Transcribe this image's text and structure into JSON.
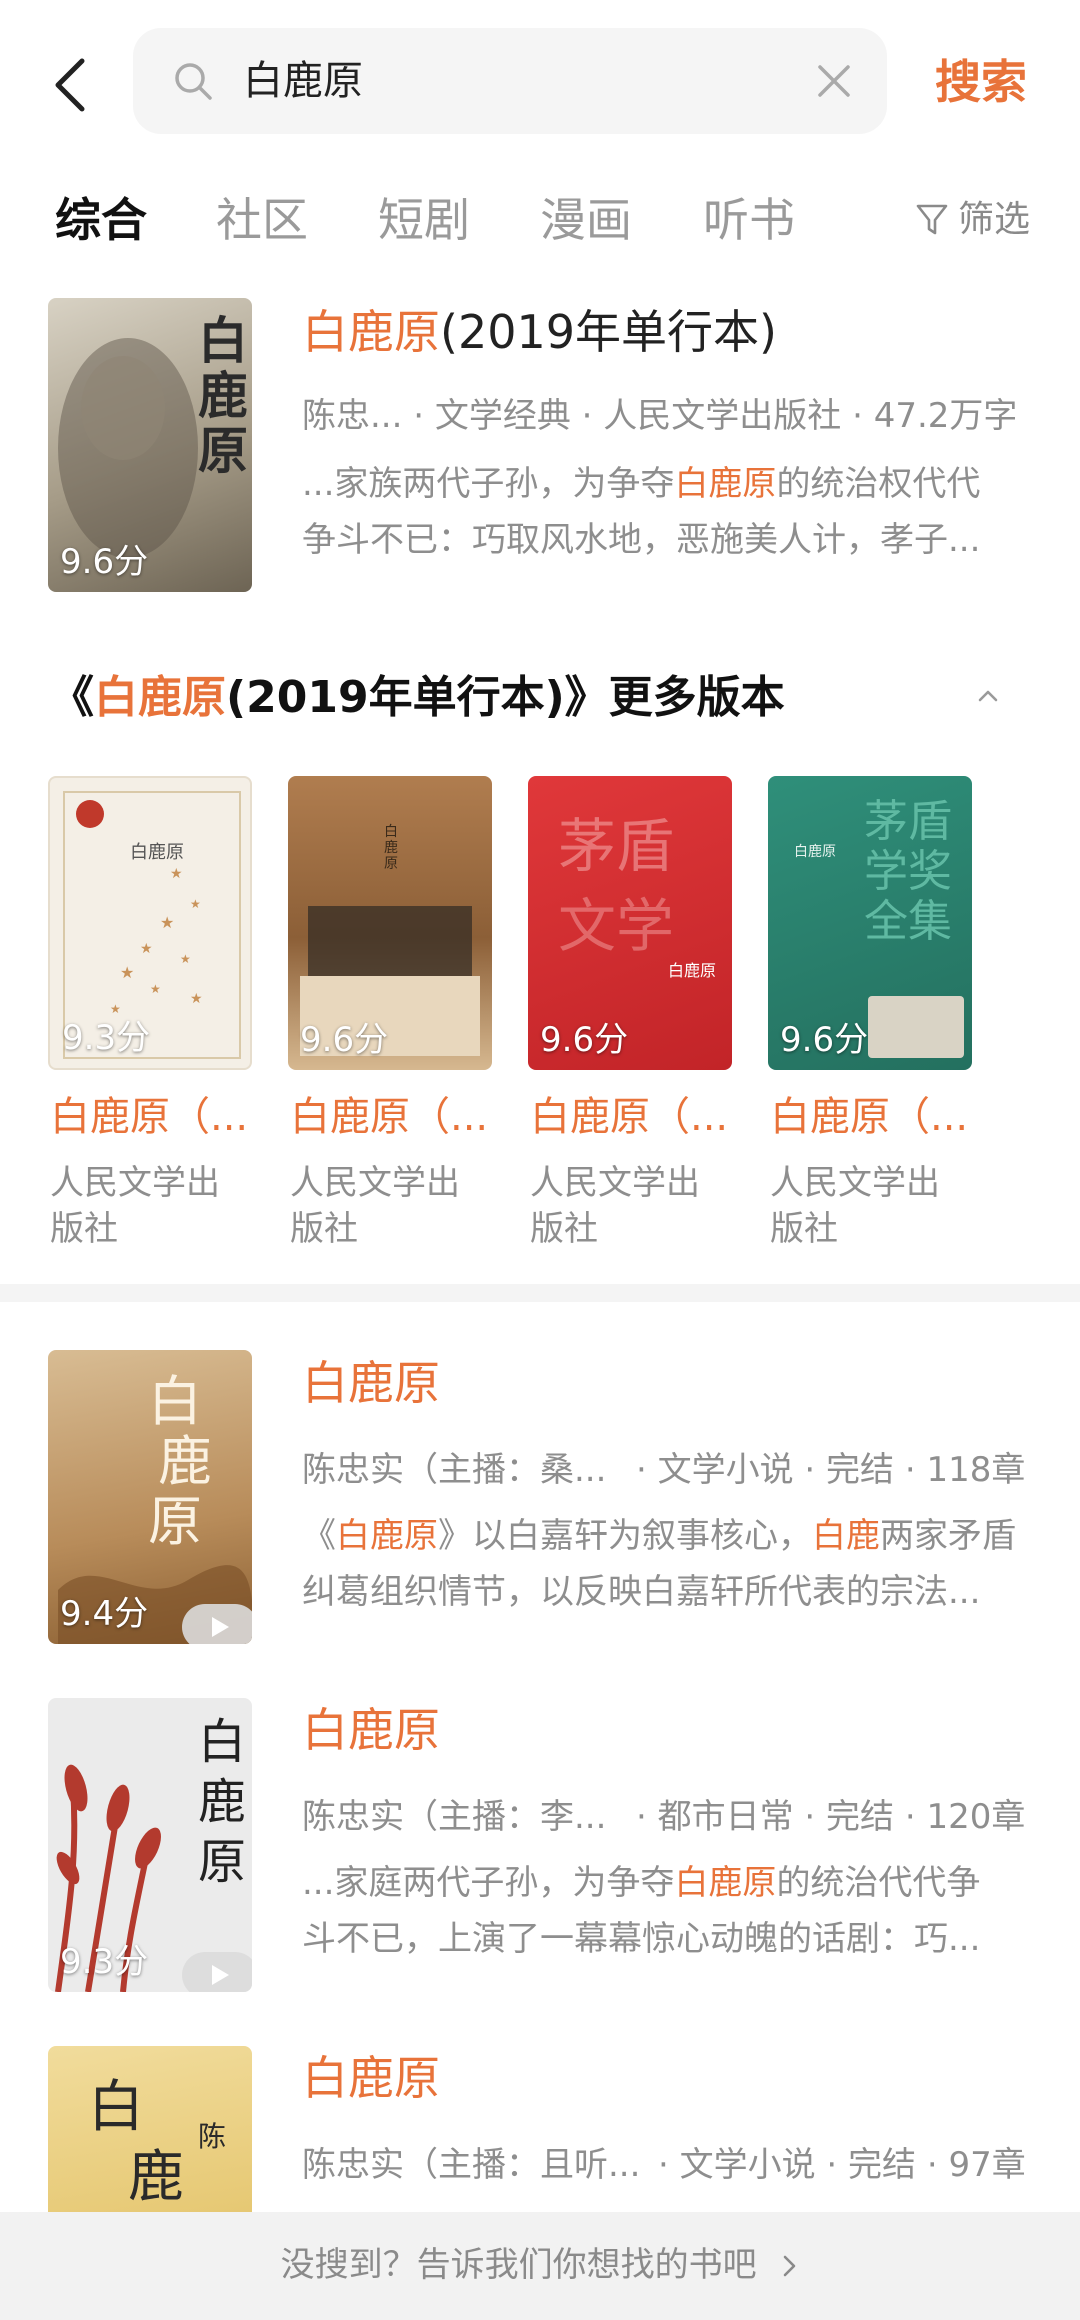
{
  "search": {
    "query": "白鹿原",
    "submit_label": "搜索"
  },
  "tabs": [
    {
      "label": "综合",
      "active": true
    },
    {
      "label": "社区",
      "active": false
    },
    {
      "label": "短剧",
      "active": false
    },
    {
      "label": "漫画",
      "active": false
    },
    {
      "label": "听书",
      "active": false
    }
  ],
  "filter_label": "筛选",
  "top_result": {
    "title_highlight": "白鹿原",
    "title_rest": "(2019年单行本)",
    "meta": "陈忠... · 文学经典 · 人民文学出版社 · 47.2万字",
    "desc_line1_pre": "...家族两代子孙，为争夺",
    "desc_line1_hl": "白鹿原",
    "desc_line1_post": "的统治权代代",
    "desc_line2": "争斗不已：巧取风水地，恶施美人计，孝子...",
    "score": "9.6分"
  },
  "more_versions": {
    "prefix": "《",
    "title_highlight": "白鹿原",
    "title_rest": "(2019年单行本)》更多版本",
    "items": [
      {
        "title": "白鹿原（...",
        "publisher": "人民文学出版社",
        "score": "9.3分"
      },
      {
        "title": "白鹿原（...",
        "publisher": "人民文学出版社",
        "score": "9.6分"
      },
      {
        "title": "白鹿原（...",
        "publisher": "人民文学出版社",
        "score": "9.6分"
      },
      {
        "title": "白鹿原（...",
        "publisher": "人民文学出版社",
        "score": "9.6分"
      }
    ]
  },
  "audio_results": [
    {
      "title": "白鹿原",
      "meta_left": "陈忠实（主播：桑...",
      "meta_right": "· 文学小说 · 完结 · 118章",
      "desc_line1_parts": [
        "《",
        "白鹿原",
        "》以白嘉轩为叙事核心，",
        "白鹿",
        "两家矛盾"
      ],
      "desc_line2": "纠葛组织情节，以反映白嘉轩所代表的宗法...",
      "score": "9.4分"
    },
    {
      "title": "白鹿原",
      "meta_left": "陈忠实（主播：李...",
      "meta_right": "· 都市日常 · 完结 · 120章",
      "desc_line1_parts": [
        "...家庭两代子孙，为争夺",
        "白鹿原",
        "的统治代代争"
      ],
      "desc_line2": "斗不已，上演了一幕幕惊心动魄的话剧：巧...",
      "score": "9.3分"
    },
    {
      "title": "白鹿原",
      "meta_left": "陈忠实（主播：且听...",
      "meta_right": "· 文学小说 · 完结 · 97章"
    }
  ],
  "footer_text": "没搜到？告诉我们你想找的书吧",
  "colors": {
    "accent": "#e8733a",
    "muted": "#8e8e8e"
  }
}
